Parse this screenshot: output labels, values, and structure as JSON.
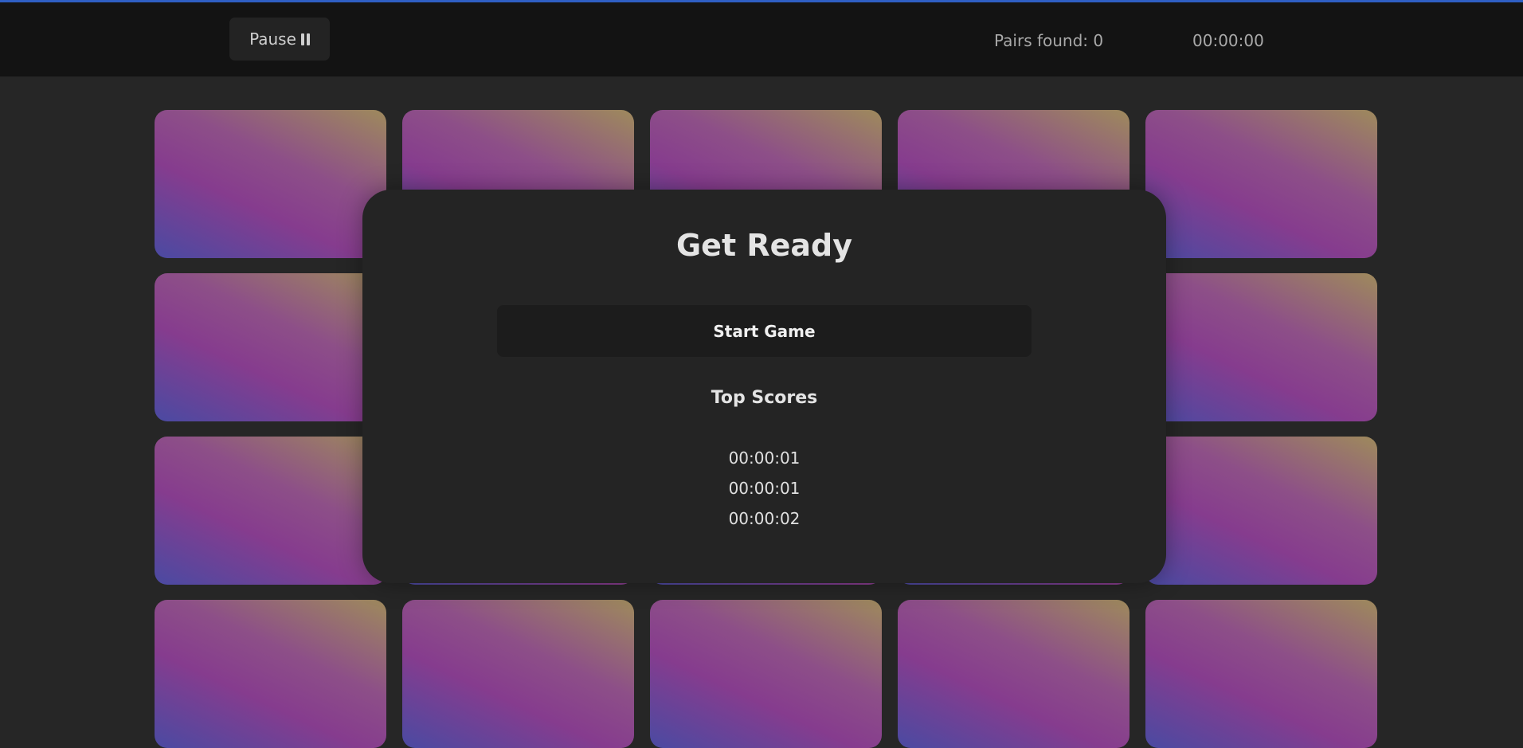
{
  "header": {
    "pause_label": "Pause",
    "pairs_found": "Pairs found: 0",
    "timer": "00:00:00"
  },
  "board": {
    "rows": 4,
    "columns": 5,
    "card_state": "face-down"
  },
  "modal": {
    "title": "Get Ready",
    "start_label": "Start Game",
    "scores_heading": "Top Scores",
    "scores": [
      "00:00:01",
      "00:00:01",
      "00:00:02"
    ]
  },
  "icons": {
    "pause": "pause-icon"
  },
  "colors": {
    "accent": "#2f5fc4",
    "card_gradient": [
      "#4a4aa2",
      "#863c8e",
      "#8d4f88",
      "#9e8a5c"
    ]
  }
}
